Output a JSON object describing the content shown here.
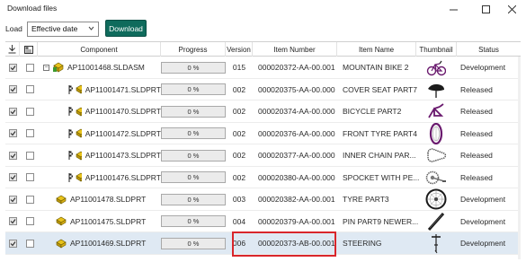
{
  "window": {
    "title": "Download files"
  },
  "toolbar": {
    "load_label": "Load",
    "load_option": "Effective date",
    "download_label": "Download"
  },
  "columns": {
    "component": "Component",
    "progress": "Progress",
    "version": "Version",
    "item_number": "Item Number",
    "item_name": "Item Name",
    "thumbnail": "Thumbnail",
    "status": "Status"
  },
  "rows": [
    {
      "component": "AP11001468.SLDASM",
      "progress": "0 %",
      "version": "015",
      "item_number": "000020372-AA-00.001",
      "item_name": "MOUNTAIN BIKE 2",
      "status": "Development",
      "checked": true,
      "thumb": "bike"
    },
    {
      "component": "AP11001471.SLDPRT",
      "progress": "0 %",
      "version": "002",
      "item_number": "000020375-AA-00.000",
      "item_name": "COVER SEAT PART7",
      "status": "Released",
      "checked": true,
      "thumb": "seat"
    },
    {
      "component": "AP11001470.SLDPRT",
      "progress": "0 %",
      "version": "002",
      "item_number": "000020374-AA-00.000",
      "item_name": "BICYCLE PART2",
      "status": "Released",
      "checked": true,
      "thumb": "frame"
    },
    {
      "component": "AP11001472.SLDPRT",
      "progress": "0 %",
      "version": "002",
      "item_number": "000020376-AA-00.000",
      "item_name": "FRONT TYRE PART4",
      "status": "Released",
      "checked": true,
      "thumb": "tyre"
    },
    {
      "component": "AP11001473.SLDPRT",
      "progress": "0 %",
      "version": "002",
      "item_number": "000020377-AA-00.000",
      "item_name": "INNER CHAIN PAR...",
      "status": "Released",
      "checked": true,
      "thumb": "chain"
    },
    {
      "component": "AP11001476.SLDPRT",
      "progress": "0 %",
      "version": "002",
      "item_number": "000020380-AA-00.000",
      "item_name": "SPOCKET WITH PE...",
      "status": "Released",
      "checked": true,
      "thumb": "sprocket"
    },
    {
      "component": "AP11001478.SLDPRT",
      "progress": "0 %",
      "version": "003",
      "item_number": "000020382-AA-00.001",
      "item_name": "TYRE PART3",
      "status": "Development",
      "checked": true,
      "thumb": "wheel"
    },
    {
      "component": "AP11001475.SLDPRT",
      "progress": "0 %",
      "version": "004",
      "item_number": "000020379-AA-00.001",
      "item_name": "PIN PART9 NEWER...",
      "status": "Development",
      "checked": true,
      "thumb": "pin"
    },
    {
      "component": "AP11001469.SLDPRT",
      "progress": "0 %",
      "version": "006",
      "item_number": "000020373-AB-00.001",
      "item_name": "STEERING",
      "status": "Development",
      "checked": true,
      "thumb": "steering"
    }
  ]
}
